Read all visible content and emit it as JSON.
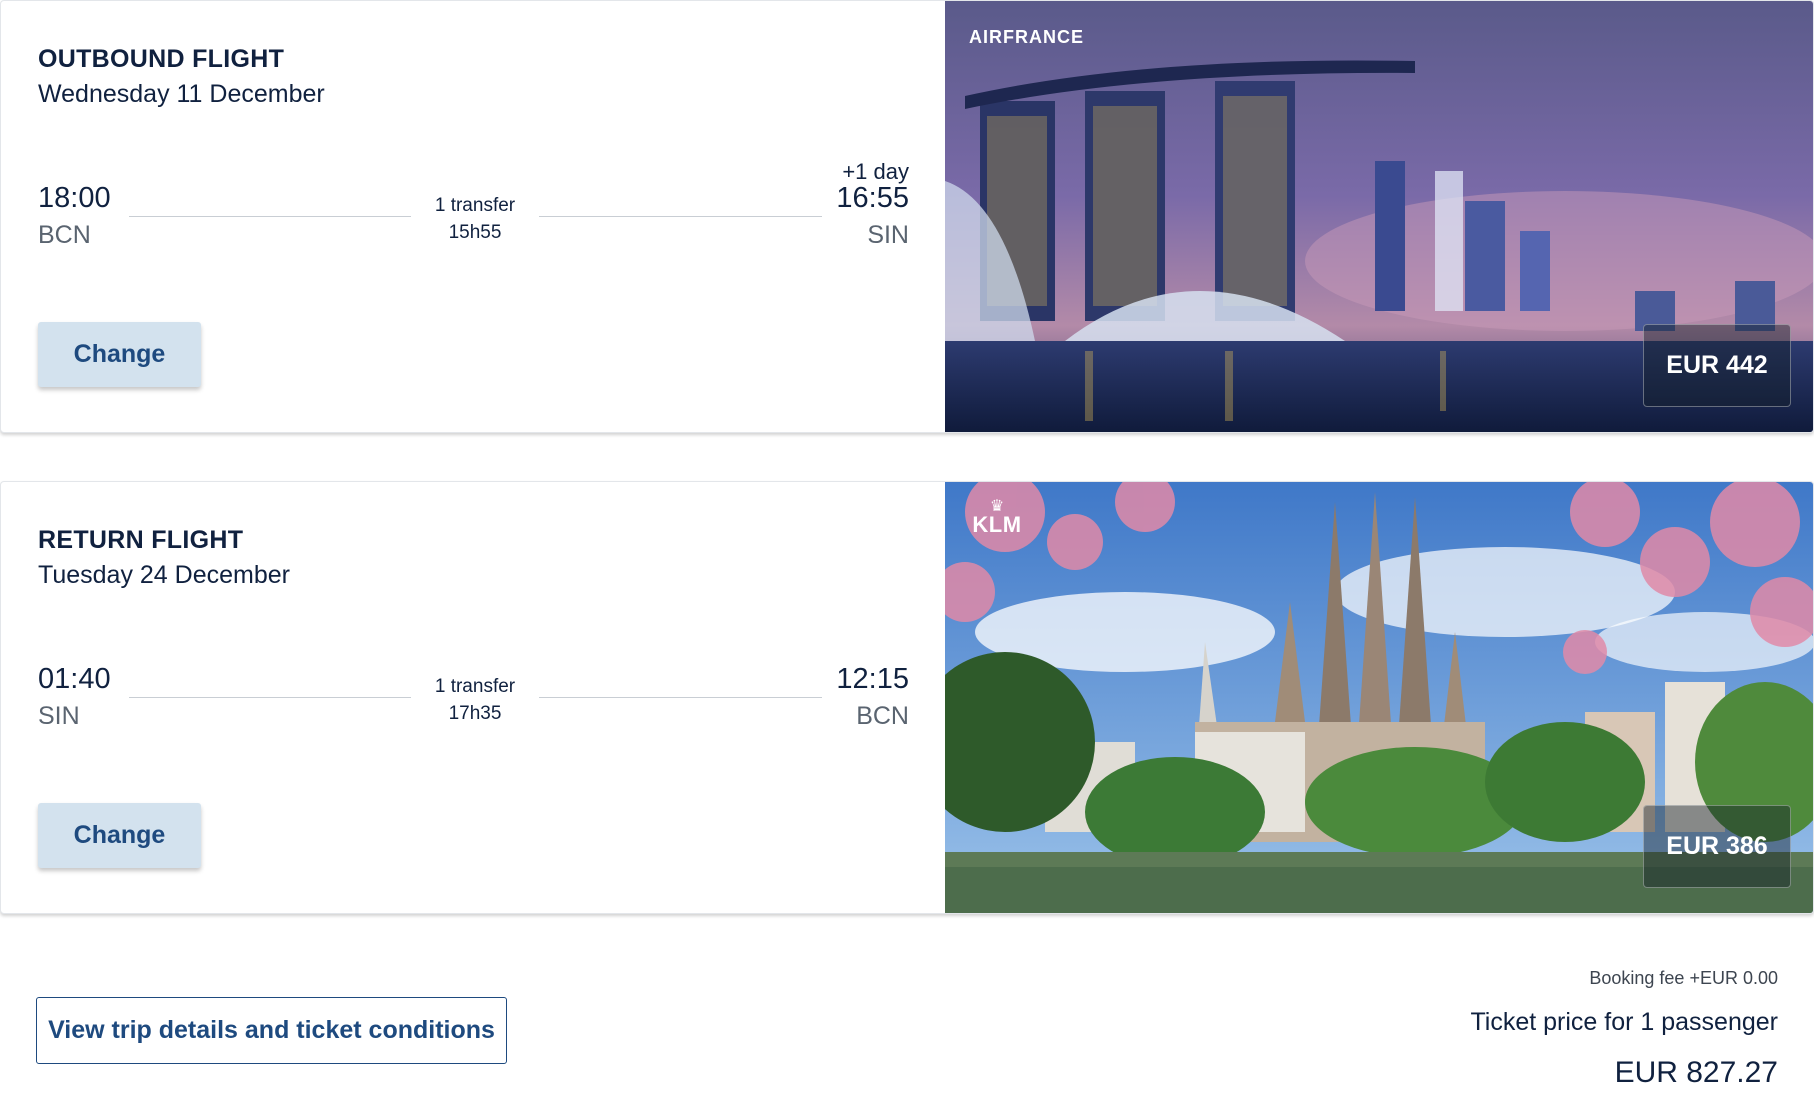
{
  "outbound": {
    "title": "OUTBOUND FLIGHT",
    "date": "Wednesday 11 December",
    "departure_time": "18:00",
    "departure_code": "BCN",
    "transfers": "1 transfer",
    "duration": "15h55",
    "day_offset": "+1 day",
    "arrival_time": "16:55",
    "arrival_code": "SIN",
    "change_label": "Change",
    "airline_logo": "AIRFRANCE",
    "price": "EUR 442"
  },
  "return": {
    "title": "RETURN FLIGHT",
    "date": "Tuesday 24 December",
    "departure_time": "01:40",
    "departure_code": "SIN",
    "transfers": "1 transfer",
    "duration": "17h35",
    "arrival_time": "12:15",
    "arrival_code": "BCN",
    "change_label": "Change",
    "airline_logo": "KLM",
    "price": "EUR 386"
  },
  "summary": {
    "details_button": "View trip details and ticket conditions",
    "booking_fee": "Booking fee +EUR 0.00",
    "ticket_label": "Ticket price for 1 passenger",
    "total": "EUR 827.27"
  },
  "icons": {
    "airfrance": "airfrance-logo-icon",
    "klm": "klm-crown-icon"
  },
  "colors": {
    "primary_text": "#10213f",
    "button_bg": "#d3e2ee",
    "button_text": "#1e4a7f",
    "secondary_text": "#5a6470"
  }
}
